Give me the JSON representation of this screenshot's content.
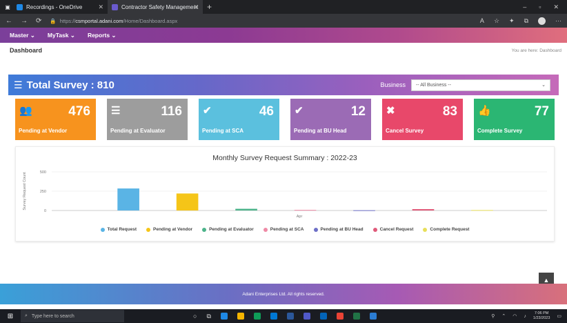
{
  "browser": {
    "tabs": [
      {
        "label": "Recordings - OneDrive",
        "active": false
      },
      {
        "label": "Contractor Safety Management",
        "active": true
      }
    ],
    "new_tab": "+",
    "window_controls": {
      "minimize": "–",
      "maximize": "▫",
      "close": "✕"
    },
    "url_prefix": "https://",
    "url_domain": "csmportal.adani.com",
    "url_path": "/Home/Dashboard.aspx"
  },
  "nav": {
    "items": [
      {
        "label": "Master ⌄"
      },
      {
        "label": "MyTask ⌄"
      },
      {
        "label": "Reports ⌄"
      }
    ]
  },
  "page": {
    "title": "Dashboard",
    "breadcrumb": "You are here:  Dashboard"
  },
  "banner": {
    "title": "Total Survey : 810",
    "business_label": "Business",
    "business_select": "-- All Business --"
  },
  "cards": [
    {
      "value": "476",
      "label": "Pending at Vendor",
      "color": "#f7931e",
      "icon": "users-icon",
      "glyph": "👥"
    },
    {
      "value": "116",
      "label": "Pending at Evaluator",
      "color": "#9d9d9d",
      "icon": "list-icon",
      "glyph": "☰"
    },
    {
      "value": "46",
      "label": "Pending at SCA",
      "color": "#5bc0de",
      "icon": "check-circle-icon",
      "glyph": "✔"
    },
    {
      "value": "12",
      "label": "Pending at BU Head",
      "color": "#9b6bb5",
      "icon": "check-circle-icon",
      "glyph": "✔"
    },
    {
      "value": "83",
      "label": "Cancel Survey",
      "color": "#e8486a",
      "icon": "cancel-circle-icon",
      "glyph": "✖"
    },
    {
      "value": "77",
      "label": "Complete Survey",
      "color": "#2bb673",
      "icon": "thumbs-up-icon",
      "glyph": "👍"
    }
  ],
  "chart_data": {
    "type": "bar",
    "title": "Monthly Survey Request Summary : 2022-23",
    "ylabel": "Survey Request Count",
    "categories": [
      "Apr"
    ],
    "ylim": [
      0,
      500
    ],
    "yticks": [
      "0",
      "250",
      "500"
    ],
    "series": [
      {
        "name": "Total Request",
        "color": "#5ab4e5",
        "values": [
          285
        ]
      },
      {
        "name": "Pending at Vendor",
        "color": "#f5c518",
        "values": [
          220
        ]
      },
      {
        "name": "Pending at Evaluator",
        "color": "#4cb38a",
        "values": [
          22
        ]
      },
      {
        "name": "Pending at SCA",
        "color": "#ef8aa6",
        "values": [
          8
        ]
      },
      {
        "name": "Pending at BU Head",
        "color": "#6d6fc7",
        "values": [
          3
        ]
      },
      {
        "name": "Cancel Request",
        "color": "#e05a7a",
        "values": [
          18
        ]
      },
      {
        "name": "Complete Request",
        "color": "#e8df5a",
        "values": [
          6
        ]
      }
    ]
  },
  "footer": {
    "text": "Adani Enterprises Ltd. All rights reserved."
  },
  "taskbar": {
    "search_placeholder": "Type here to search",
    "time": "7:06 PM",
    "date": "1/23/2023"
  }
}
